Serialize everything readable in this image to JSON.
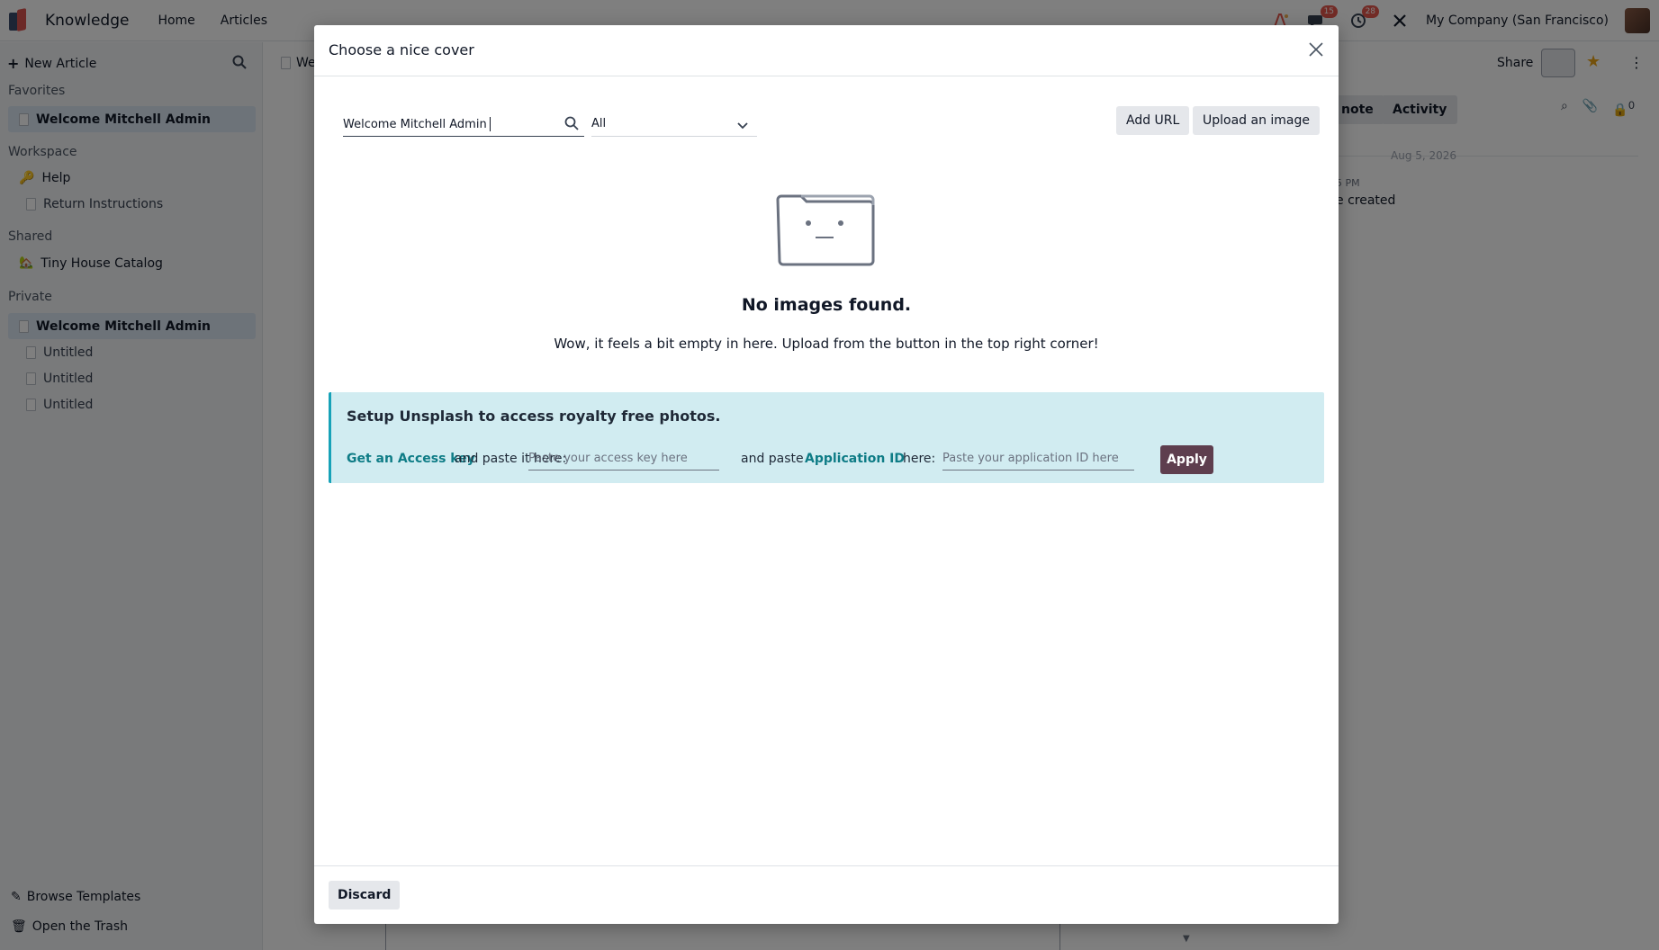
{
  "app": {
    "name": "Knowledge",
    "menu": [
      "Home",
      "Articles"
    ],
    "company": "My Company (San Francisco)",
    "badges": {
      "messages": "15",
      "activities": "28"
    }
  },
  "sidebar": {
    "new_article": "New Article",
    "sections": {
      "favorites": "Favorites",
      "workspace": "Workspace",
      "shared": "Shared",
      "private": "Private"
    },
    "favorites": [
      {
        "label": "Welcome Mitchell Admin"
      }
    ],
    "workspace": [
      {
        "label": "Help"
      },
      {
        "label": "Return Instructions"
      }
    ],
    "shared": [
      {
        "label": "Tiny House Catalog"
      }
    ],
    "private": [
      {
        "label": "Welcome Mitchell Admin"
      },
      {
        "label": "Untitled"
      },
      {
        "label": "Untitled"
      },
      {
        "label": "Untitled"
      }
    ],
    "browse_templates": "Browse Templates",
    "open_trash": "Open the Trash"
  },
  "background": {
    "doc_title_partial": "We",
    "share": "Share",
    "chatter_tabs": [
      "note",
      "Activity"
    ],
    "follower_count": "0",
    "date": "Aug 5, 2026",
    "time_partial": "5 PM",
    "created_text": "e created"
  },
  "modal": {
    "title": "Choose a nice cover",
    "search_value": "Welcome Mitchell Admin",
    "filter_value": "All",
    "add_url": "Add URL",
    "upload_image": "Upload an image",
    "empty_title": "No images found.",
    "empty_subtitle": "Wow, it feels a bit empty in here. Upload from the button in the top right corner!",
    "unsplash": {
      "title": "Setup Unsplash to access royalty free photos.",
      "access_key_link": "Get an Access key",
      "text_paste_here": "and paste it here:",
      "access_key_placeholder": "Paste your access key here",
      "text_and_paste": "and paste",
      "app_id_link": "Application ID",
      "text_here": "here:",
      "app_id_placeholder": "Paste your application ID here",
      "apply": "Apply"
    },
    "discard": "Discard"
  },
  "colors": {
    "primary": "#5e3e4e",
    "link": "#0e7c86",
    "alert_bg": "#d1ecf1",
    "active_item": "#dbe7f3"
  }
}
